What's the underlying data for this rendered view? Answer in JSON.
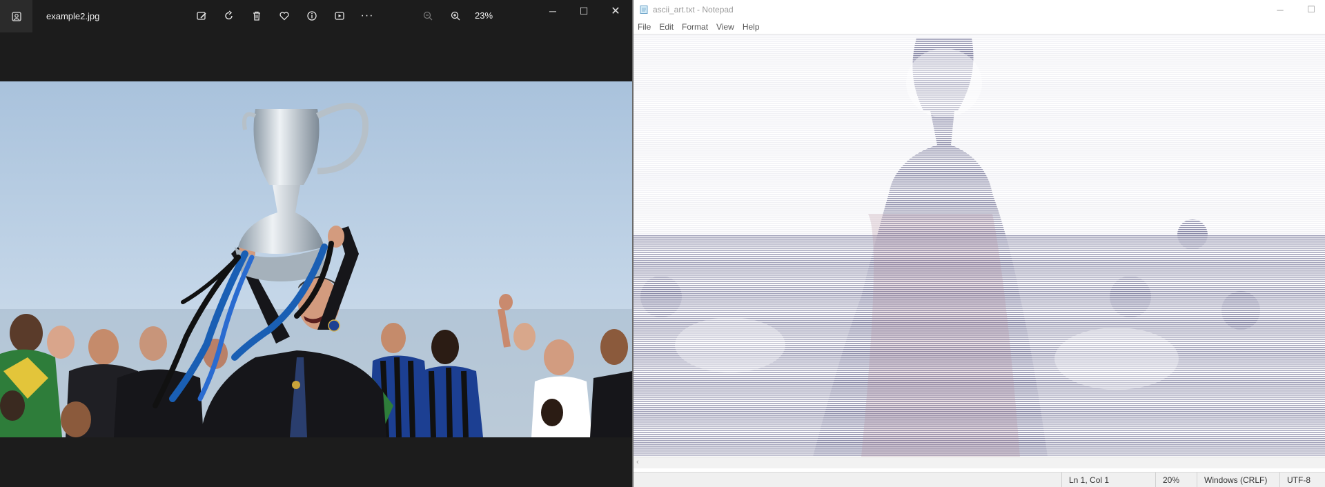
{
  "photos_app": {
    "filename": "example2.jpg",
    "zoom_level": "23%",
    "toolbar_icons": [
      "edit-image-icon",
      "rotate-icon",
      "delete-icon",
      "favorite-heart-icon",
      "info-icon",
      "slideshow-icon",
      "more-icon"
    ],
    "zoom_icons": [
      "zoom-out-icon",
      "zoom-in-icon"
    ],
    "window_controls": {
      "minimize": "─",
      "maximize": "☐",
      "close": "✕"
    },
    "more_glyph": "···"
  },
  "notepad": {
    "title": "ascii_art.txt - Notepad",
    "menu": [
      "File",
      "Edit",
      "Format",
      "View",
      "Help"
    ],
    "window_controls": {
      "minimize": "─",
      "maximize": "☐"
    },
    "status": {
      "position": "Ln 1, Col 1",
      "zoom": "20%",
      "line_ending": "Windows (CRLF)",
      "encoding": "UTF-8"
    }
  },
  "colors": {
    "photos_bg": "#1c1c1c",
    "sky": "#b6cbe0",
    "notepad_bg": "#ffffff",
    "ascii_ink": "#8a8aa8"
  }
}
